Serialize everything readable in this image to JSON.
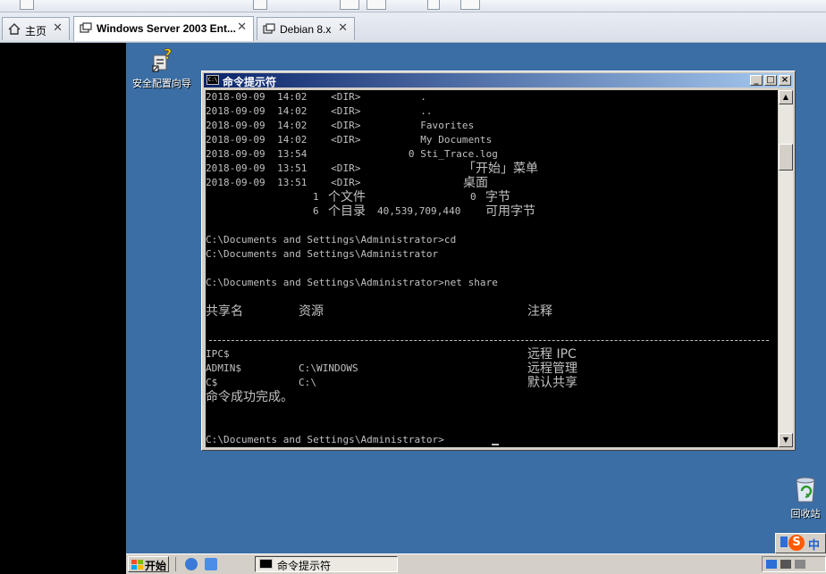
{
  "tabs": [
    {
      "label": "主页"
    },
    {
      "label": "Windows Server 2003 Ent..."
    },
    {
      "label": "Debian 8.x"
    }
  ],
  "desktop": {
    "icon_security": "安全配置向导",
    "icon_recycle": "回收站"
  },
  "window": {
    "title": "命令提示符",
    "min": "_",
    "max": "□",
    "close": "×"
  },
  "console": {
    "dir_lines": [
      "2018-09-09  14:02    <DIR>          .",
      "2018-09-09  14:02    <DIR>          ..",
      "2018-09-09  14:02    <DIR>          Favorites",
      "2018-09-09  14:02    <DIR>          My Documents",
      "2018-09-09  13:54                 0 Sti_Trace.log",
      "2018-09-09  13:51    <DIR>          ",
      "2018-09-09  13:51    <DIR>          "
    ],
    "startmenu_dir": "「开始」菜单",
    "desktop_dir": "桌面",
    "files_count": "1",
    "files_label": "个文件",
    "files_bytes": "0",
    "bytes_label": "字节",
    "dirs_count": "6",
    "dirs_label": "个目录",
    "free_bytes": "40,539,709,440",
    "free_label": "可用字节",
    "cmd1": "C:\\Documents and Settings\\Administrator>cd",
    "cmd1_out": "C:\\Documents and Settings\\Administrator",
    "cmd2": "C:\\Documents and Settings\\Administrator>net share",
    "hdr_share": "共享名",
    "hdr_resource": "资源",
    "hdr_remark": "注释",
    "shares": [
      {
        "name": "IPC$",
        "resource": "",
        "remark": "远程 IPC"
      },
      {
        "name": "ADMIN$",
        "resource": "C:\\WINDOWS",
        "remark": "远程管理"
      },
      {
        "name": "C$",
        "resource": "C:\\",
        "remark": "默认共享"
      }
    ],
    "done": "命令成功完成。",
    "prompt": "C:\\Documents and Settings\\Administrator>"
  },
  "taskbar": {
    "start": "开始",
    "task_cmd": "命令提示符"
  },
  "colors": {
    "desktop": "#3a6ea5",
    "console_bg": "#000000",
    "console_fg": "#c0c0c0",
    "title_start": "#0a246a",
    "title_end": "#a6caf0"
  }
}
